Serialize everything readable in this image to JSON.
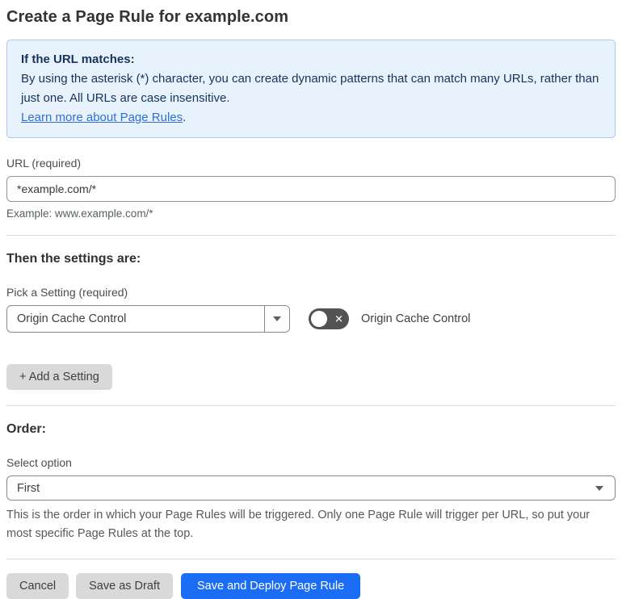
{
  "page": {
    "title": "Create a Page Rule for example.com"
  },
  "info_box": {
    "heading": "If the URL matches:",
    "body": "By using the asterisk (*) character, you can create dynamic patterns that can match many URLs, rather than just one. All URLs are case insensitive.",
    "link": "Learn more about Page Rules",
    "link_suffix": "."
  },
  "url_field": {
    "label": "URL (required)",
    "value": "*example.com/*",
    "example": "Example: www.example.com/*"
  },
  "settings_section": {
    "heading": "Then the settings are:",
    "picker_label": "Pick a Setting (required)",
    "selected_setting": "Origin Cache Control",
    "toggle_label": "Origin Cache Control",
    "toggle_state": "off",
    "toggle_glyph": "✕",
    "add_setting_label": "+ Add a Setting"
  },
  "order_section": {
    "heading": "Order:",
    "select_label": "Select option",
    "selected_option": "First",
    "help_text": "This is the order in which your Page Rules will be triggered. Only one Page Rule will trigger per URL, so put your most specific Page Rules at the top."
  },
  "footer": {
    "cancel_label": "Cancel",
    "save_draft_label": "Save as Draft",
    "save_deploy_label": "Save and Deploy Page Rule"
  },
  "colors": {
    "info_bg": "#e8f2fc",
    "info_border": "#a9c9ee",
    "info_text": "#16335c",
    "link_blue": "#2f6fd6",
    "primary_button_blue": "#1b6ef3",
    "toggle_off_gray": "#535353",
    "secondary_button_gray": "#d9d9d9"
  }
}
